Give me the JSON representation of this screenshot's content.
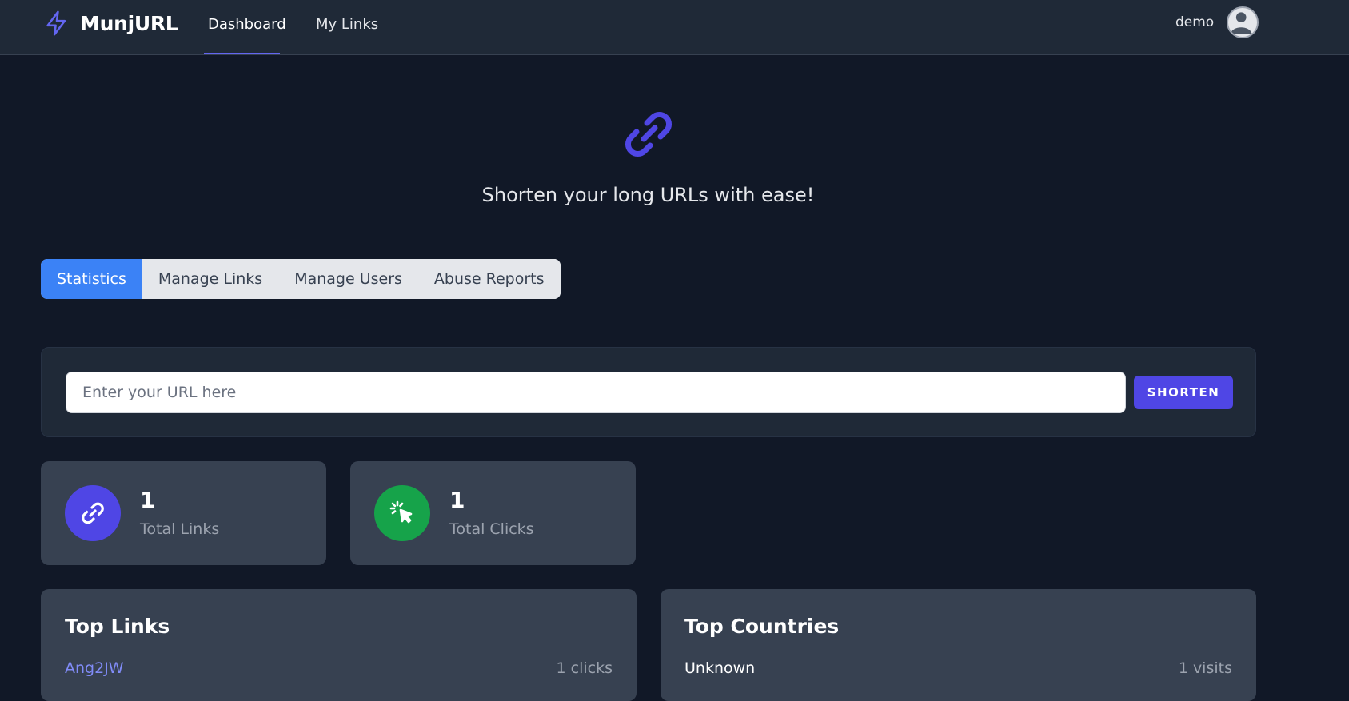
{
  "app": {
    "name": "MunjURL"
  },
  "nav": {
    "items": [
      {
        "label": "Dashboard",
        "active": true
      },
      {
        "label": "My Links",
        "active": false
      }
    ]
  },
  "user": {
    "name": "demo"
  },
  "hero": {
    "tagline": "Shorten your long URLs with ease!"
  },
  "tabs": [
    {
      "label": "Statistics",
      "active": true
    },
    {
      "label": "Manage Links",
      "active": false
    },
    {
      "label": "Manage Users",
      "active": false
    },
    {
      "label": "Abuse Reports",
      "active": false
    }
  ],
  "shorten": {
    "placeholder": "Enter your URL here",
    "value": "",
    "button_label": "SHORTEN"
  },
  "stats": {
    "total_links": {
      "value": "1",
      "label": "Total Links"
    },
    "total_clicks": {
      "value": "1",
      "label": "Total Clicks"
    }
  },
  "top_links": {
    "title": "Top Links",
    "rows": [
      {
        "name": "Ang2JW",
        "count": "1 clicks"
      }
    ]
  },
  "top_countries": {
    "title": "Top Countries",
    "rows": [
      {
        "name": "Unknown",
        "count": "1 visits"
      }
    ]
  },
  "colors": {
    "accent": "#4f46e5",
    "tab_active": "#3b82f6",
    "clicks_icon": "#16a34a",
    "link_text": "#818cf8"
  },
  "icons": {
    "brand": "bolt-icon",
    "hero": "link-icon",
    "avatar": "user-circle-icon",
    "links_stat": "link-icon",
    "clicks_stat": "cursor-click-icon"
  }
}
